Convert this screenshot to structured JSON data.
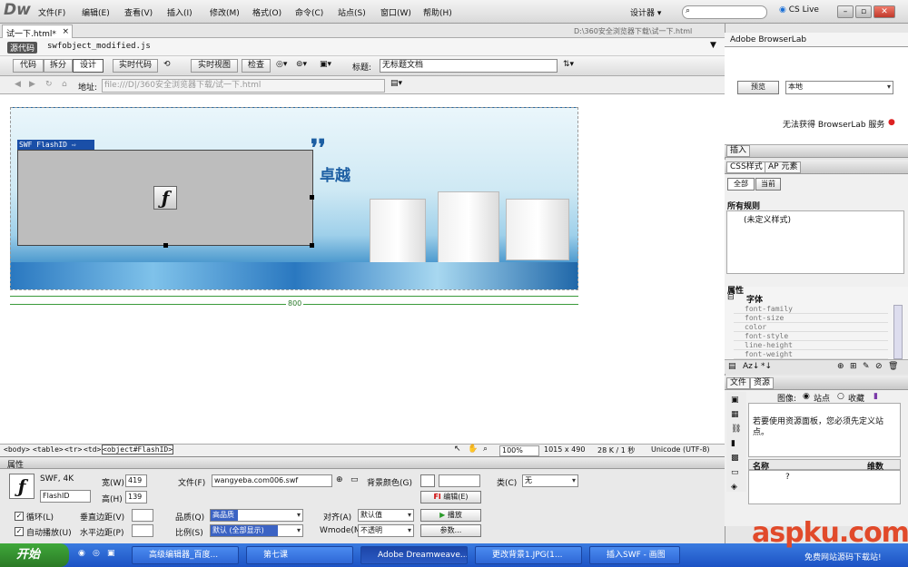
{
  "app": {
    "logo": "Dw",
    "workspace": "设计器 ▾",
    "cslive": "CS Live"
  },
  "menu": [
    "文件(F)",
    "编辑(E)",
    "查看(V)",
    "插入(I)",
    "修改(M)",
    "格式(O)",
    "命令(C)",
    "站点(S)",
    "窗口(W)",
    "帮助(H)"
  ],
  "doc": {
    "tab": "试一下.html*",
    "path": "D:\\360安全浏览器下载\\试一下.html",
    "source_badge": "源代码",
    "related_file": "swfobject_modified.js"
  },
  "toolbar": {
    "code": "代码",
    "split": "拆分",
    "design": "设计",
    "live_code": "实时代码",
    "live_view": "实时视图",
    "inspect": "检查",
    "title_label": "标题:",
    "title_value": "无标题文档"
  },
  "address": {
    "label": "地址:",
    "value": "file:///D|/360安全浏览器下载/试一下.html"
  },
  "design": {
    "swf_label": "SWF    FlashID",
    "banner_text": "卓越",
    "ruler_width": "800"
  },
  "tagbar": {
    "tags": [
      "<body>",
      "<table>",
      "<tr>",
      "<td>",
      "<object#FlashID>"
    ],
    "zoom": "100%",
    "size": "1015 x 490",
    "filesize": "28 K / 1 秒",
    "encoding": "Unicode (UTF-8)"
  },
  "props": {
    "title": "属性",
    "swf_info": "SWF, 4K",
    "id": "FlashID",
    "width_label": "宽(W)",
    "width": "419",
    "height_label": "高(H)",
    "height": "139",
    "file_label": "文件(F)",
    "file": "wangyeba.com006.swf",
    "bg_label": "背景颜色(G)",
    "class_label": "类(C)",
    "class_value": "无",
    "edit": "编辑(E)",
    "loop": "循环(L)",
    "autoplay": "自动播放(U)",
    "vspace": "垂直边距(V)",
    "hspace": "水平边距(P)",
    "quality_label": "品质(Q)",
    "quality": "高品质",
    "scale_label": "比例(S)",
    "scale": "默认 (全部显示)",
    "align_label": "对齐(A)",
    "align": "默认值",
    "wmode_label": "Wmode(M)",
    "wmode": "不透明",
    "play": "播放",
    "params": "参数..."
  },
  "right": {
    "browserlab": "Adobe BrowserLab",
    "preview": "预览",
    "local": "本地",
    "browserlab_msg": "无法获得 BrowserLab 服务",
    "insert": "插入",
    "css_tab": "CSS样式",
    "ap_tab": "AP 元素",
    "all": "全部",
    "current": "当前",
    "all_rules": "所有规则",
    "undefined_style": "(未定义样式)",
    "props": "属性",
    "font": "字体",
    "font_props": [
      "font-family",
      "font-size",
      "color",
      "font-style",
      "line-height",
      "font-weight"
    ],
    "files_tab": "文件",
    "assets_tab": "资源",
    "images": "图像:",
    "site": "站点",
    "favorites": "收藏",
    "assets_msg": "若要使用资源面板，您必须先定义站点。",
    "name_col": "名称",
    "dim_col": "维数"
  },
  "taskbar": {
    "start": "开始",
    "tasks": [
      "高级编辑器_百度...",
      "第七课",
      "Adobe Dreamweave...",
      "更改背景1.JPG(1...",
      "插入SWF - 画图"
    ],
    "watermark": "aspku.com",
    "watermark_sub": "免费网站源码下载站!"
  }
}
